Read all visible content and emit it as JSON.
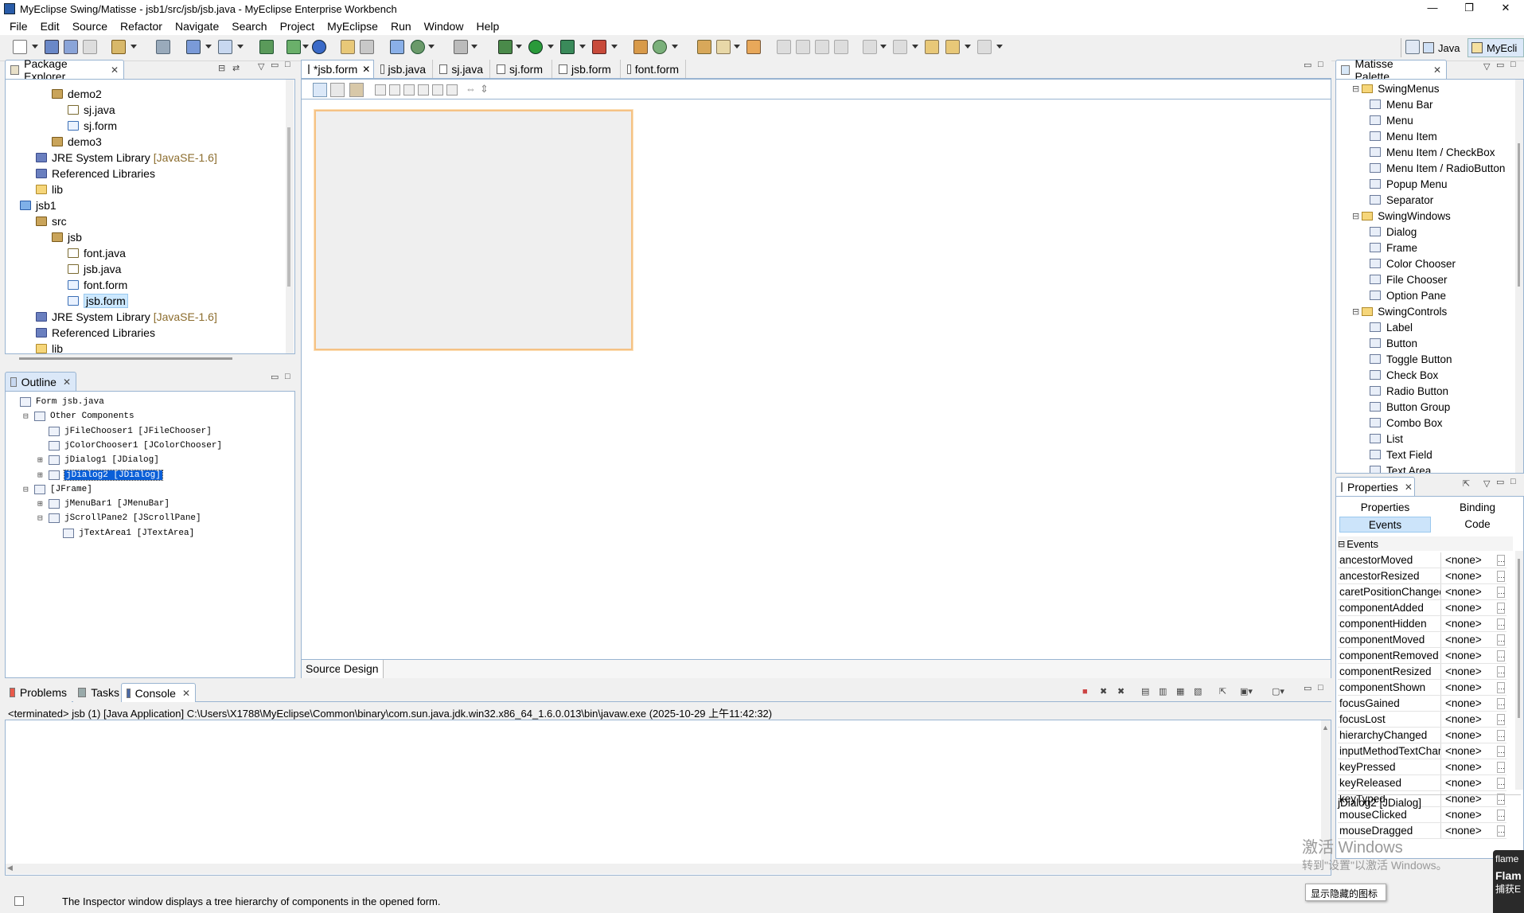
{
  "window": {
    "title": "MyEclipse Swing/Matisse - jsb1/src/jsb/jsb.java - MyEclipse Enterprise Workbench",
    "minimize": "—",
    "maximize": "❐",
    "close": "✕"
  },
  "menu": [
    "File",
    "Edit",
    "Source",
    "Refactor",
    "Navigate",
    "Search",
    "Project",
    "MyEclipse",
    "Run",
    "Window",
    "Help"
  ],
  "perspectives": {
    "java": "Java",
    "myeclipse": "MyEcli"
  },
  "package_explorer": {
    "tab": "Package Explorer",
    "rows": [
      {
        "label": "demo2",
        "extra": "",
        "kind": "pkg",
        "indent": 2
      },
      {
        "label": "sj.java",
        "extra": "",
        "kind": "java",
        "indent": 3
      },
      {
        "label": "sj.form",
        "extra": "",
        "kind": "form",
        "indent": 3
      },
      {
        "label": "demo3",
        "extra": "",
        "kind": "pkg",
        "indent": 2
      },
      {
        "label": "JRE System Library",
        "extra": "[JavaSE-1.6]",
        "kind": "lib",
        "indent": 1
      },
      {
        "label": "Referenced Libraries",
        "extra": "",
        "kind": "lib",
        "indent": 1
      },
      {
        "label": "lib",
        "extra": "",
        "kind": "fold",
        "indent": 1
      },
      {
        "label": "jsb1",
        "extra": "",
        "kind": "proj",
        "indent": 0
      },
      {
        "label": "src",
        "extra": "",
        "kind": "pkg",
        "indent": 1
      },
      {
        "label": "jsb",
        "extra": "",
        "kind": "pkg",
        "indent": 2
      },
      {
        "label": "font.java",
        "extra": "",
        "kind": "java",
        "indent": 3
      },
      {
        "label": "jsb.java",
        "extra": "",
        "kind": "java",
        "indent": 3
      },
      {
        "label": "font.form",
        "extra": "",
        "kind": "form",
        "indent": 3
      },
      {
        "label": "jsb.form",
        "extra": "",
        "kind": "form",
        "indent": 3,
        "selected": true
      },
      {
        "label": "JRE System Library",
        "extra": "[JavaSE-1.6]",
        "kind": "lib",
        "indent": 1
      },
      {
        "label": "Referenced Libraries",
        "extra": "",
        "kind": "lib",
        "indent": 1
      },
      {
        "label": "lib",
        "extra": "",
        "kind": "fold",
        "indent": 1
      }
    ]
  },
  "outline": {
    "tab": "Outline",
    "rows": [
      {
        "label": "Form jsb.java",
        "toggle": "",
        "indent": 0
      },
      {
        "label": "Other Components",
        "toggle": "⊟",
        "indent": 1
      },
      {
        "label": "jFileChooser1 [JFileChooser]",
        "toggle": "",
        "indent": 2
      },
      {
        "label": "jColorChooser1 [JColorChooser]",
        "toggle": "",
        "indent": 2
      },
      {
        "label": "jDialog1 [JDialog]",
        "toggle": "⊞",
        "indent": 2
      },
      {
        "label": "jDialog2 [JDialog]",
        "toggle": "⊞",
        "indent": 2,
        "selected": true
      },
      {
        "label": "[JFrame]",
        "toggle": "⊟",
        "indent": 1
      },
      {
        "label": "jMenuBar1 [JMenuBar]",
        "toggle": "⊞",
        "indent": 2
      },
      {
        "label": "jScrollPane2 [JScrollPane]",
        "toggle": "⊟",
        "indent": 2
      },
      {
        "label": "jTextArea1 [JTextArea]",
        "toggle": "",
        "indent": 3
      }
    ]
  },
  "editor": {
    "tabs": [
      "*jsb.form",
      "jsb.java",
      "sj.java",
      "sj.form",
      "jsb.form",
      "font.form"
    ],
    "active_tab": 0,
    "bottom_tabs": [
      "Source",
      "Design"
    ]
  },
  "palette": {
    "tab": "Matisse Palette",
    "rows": [
      {
        "label": "SwingMenus",
        "cat": true
      },
      {
        "label": "Menu Bar"
      },
      {
        "label": "Menu"
      },
      {
        "label": "Menu Item"
      },
      {
        "label": "Menu Item / CheckBox"
      },
      {
        "label": "Menu Item / RadioButton"
      },
      {
        "label": "Popup Menu"
      },
      {
        "label": "Separator"
      },
      {
        "label": "SwingWindows",
        "cat": true
      },
      {
        "label": "Dialog"
      },
      {
        "label": "Frame"
      },
      {
        "label": "Color Chooser"
      },
      {
        "label": "File Chooser"
      },
      {
        "label": "Option Pane"
      },
      {
        "label": "SwingControls",
        "cat": true
      },
      {
        "label": "Label"
      },
      {
        "label": "Button"
      },
      {
        "label": "Toggle Button"
      },
      {
        "label": "Check Box"
      },
      {
        "label": "Radio Button"
      },
      {
        "label": "Button Group"
      },
      {
        "label": "Combo Box"
      },
      {
        "label": "List"
      },
      {
        "label": "Text Field"
      },
      {
        "label": "Text Area"
      }
    ]
  },
  "properties": {
    "tab": "Properties",
    "subtabs": [
      "Properties",
      "Binding",
      "Events",
      "Code"
    ],
    "active_subtab": "Events",
    "section": "Events",
    "events": [
      {
        "name": "ancestorMoved",
        "value": "<none>"
      },
      {
        "name": "ancestorResized",
        "value": "<none>"
      },
      {
        "name": "caretPositionChanged",
        "value": "<none>"
      },
      {
        "name": "componentAdded",
        "value": "<none>"
      },
      {
        "name": "componentHidden",
        "value": "<none>"
      },
      {
        "name": "componentMoved",
        "value": "<none>"
      },
      {
        "name": "componentRemoved",
        "value": "<none>"
      },
      {
        "name": "componentResized",
        "value": "<none>"
      },
      {
        "name": "componentShown",
        "value": "<none>"
      },
      {
        "name": "focusGained",
        "value": "<none>"
      },
      {
        "name": "focusLost",
        "value": "<none>"
      },
      {
        "name": "hierarchyChanged",
        "value": "<none>"
      },
      {
        "name": "inputMethodTextChan",
        "value": "<none>"
      },
      {
        "name": "keyPressed",
        "value": "<none>"
      },
      {
        "name": "keyReleased",
        "value": "<none>"
      },
      {
        "name": "keyTyped",
        "value": "<none>"
      },
      {
        "name": "mouseClicked",
        "value": "<none>"
      },
      {
        "name": "mouseDragged",
        "value": "<none>"
      }
    ],
    "selection": "jDialog2 [JDialog]"
  },
  "bottom": {
    "tabs": [
      "Problems",
      "Tasks",
      "Console"
    ],
    "console_header": "<terminated> jsb (1) [Java Application] C:\\Users\\X1788\\MyEclipse\\Common\\binary\\com.sun.java.jdk.win32.x86_64_1.6.0.013\\bin\\javaw.exe (2025-10-29 上午11:42:32)"
  },
  "status": {
    "message": "The Inspector window displays a tree hierarchy of components in the opened form."
  },
  "watermark": {
    "line1": "激活 Windows",
    "line2": "转到\"设置\"以激活 Windows。"
  },
  "tray": {
    "tooltip": "显示隐藏的图标",
    "app1": "flame",
    "app2": "Flam",
    "app3": "捕获E"
  }
}
